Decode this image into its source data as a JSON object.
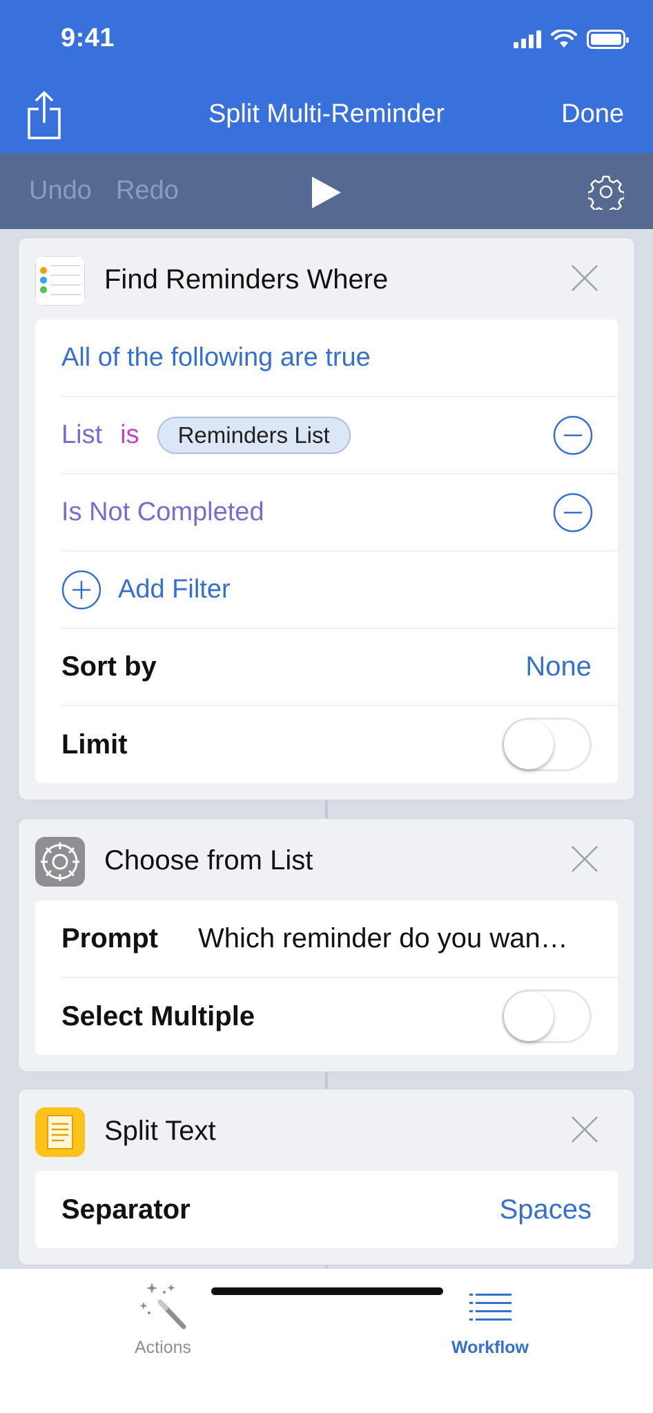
{
  "status_bar": {
    "time": "9:41"
  },
  "nav": {
    "title": "Split Multi-Reminder",
    "done_label": "Done"
  },
  "toolbar": {
    "undo_label": "Undo",
    "redo_label": "Redo"
  },
  "actions": [
    {
      "title": "Find Reminders Where",
      "match_label": "All of the following are true",
      "filters": [
        {
          "property": "List",
          "operator": "is",
          "value": "Reminders List"
        },
        {
          "property": "Is Not Completed"
        }
      ],
      "add_filter_label": "Add Filter",
      "sort_label": "Sort by",
      "sort_value": "None",
      "limit_label": "Limit",
      "limit_enabled": false
    },
    {
      "title": "Choose from List",
      "prompt_label": "Prompt",
      "prompt_value": "Which reminder do you wan…",
      "select_multiple_label": "Select Multiple",
      "select_multiple_enabled": false
    },
    {
      "title": "Split Text",
      "separator_label": "Separator",
      "separator_value": "Spaces"
    }
  ],
  "tabbar": {
    "actions_label": "Actions",
    "workflow_label": "Workflow"
  },
  "colors": {
    "header": "#3870dc",
    "toolbar": "#546a90",
    "accent": "#3670cf",
    "purple": "#7a6bd1",
    "magenta": "#c444b9"
  },
  "icons": {
    "share": "share-icon",
    "play": "play-icon",
    "settings": "gear-icon",
    "reminders": "reminders-app-icon",
    "scripting": "gear-app-icon",
    "text": "notes-app-icon",
    "close": "close-icon",
    "remove": "minus-circle-icon",
    "add": "plus-circle-icon",
    "actions_tab": "magic-wand-icon",
    "workflow_tab": "list-icon"
  }
}
